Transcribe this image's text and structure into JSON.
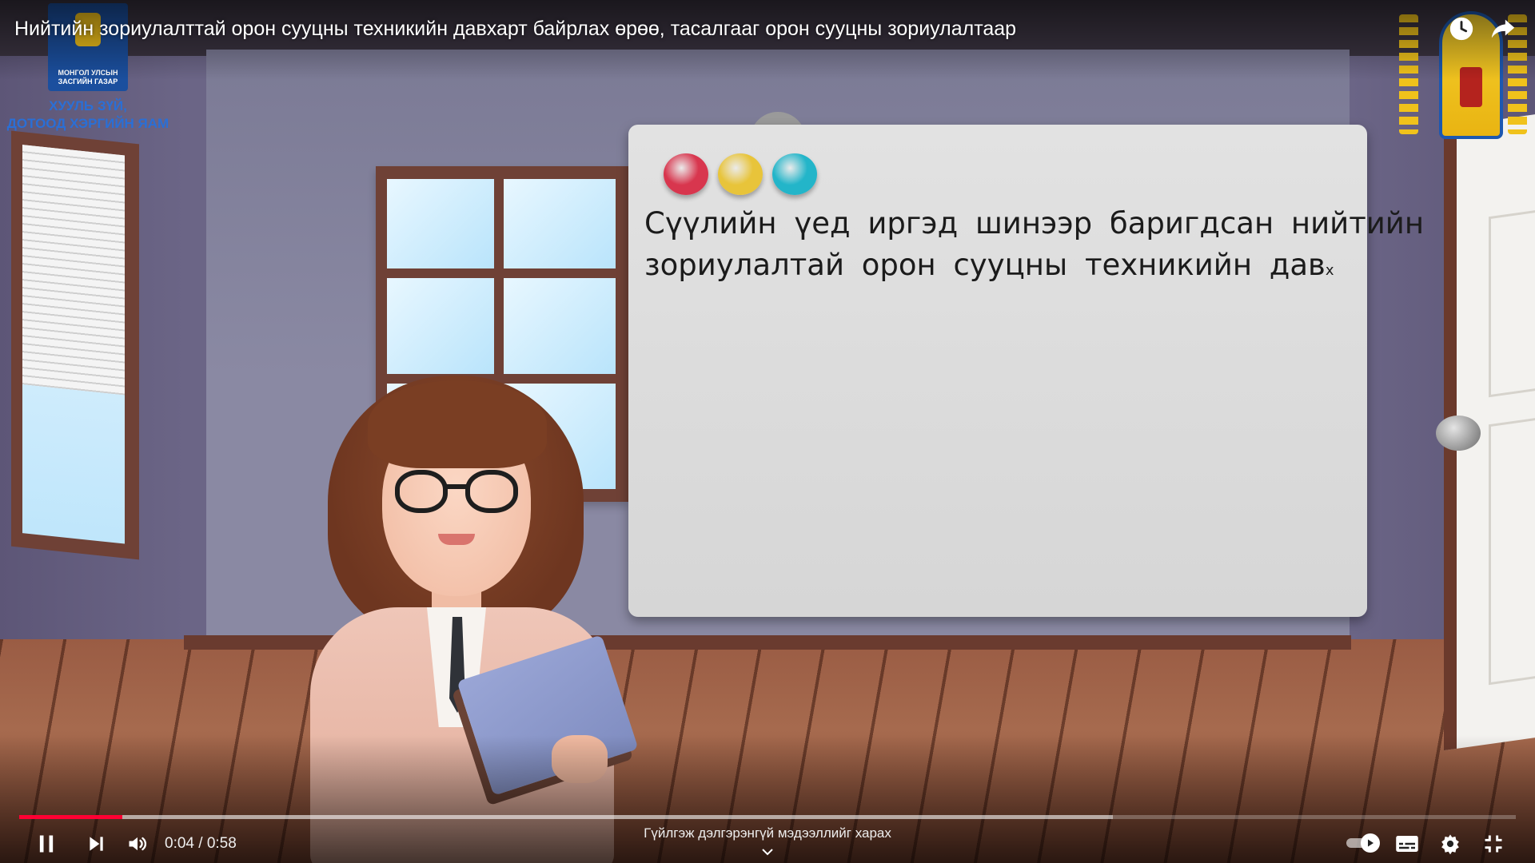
{
  "video": {
    "title": "Нийтийн зориулалттай орон сууцны техникийн давхарт байрлах өрөө, тасалгааг орон сууцны зориулалтаар"
  },
  "board": {
    "line1": "Сүүлийн үед иргэд шинээр баригдсан нийтийн",
    "line2": "зориулалтай орон сууцны техникийн дав",
    "typing_mark": "х",
    "pins": [
      "#d8364e",
      "#e8c43a",
      "#23b5c9"
    ]
  },
  "logos": {
    "left_text": "МОНГОЛ УЛСЫН ЗАСГИЙН ГАЗАР",
    "ministry_line1": "ХУУЛЬ ЗҮЙ,",
    "ministry_line2": "ДОТООД ХЭРГИЙН ЯАМ"
  },
  "player": {
    "current_time": "0:04",
    "separator": "/",
    "duration": "0:58",
    "played_fraction": 0.069,
    "buffered_fraction": 0.731,
    "hint": "Гүйлгэж дэлгэрэнгүй мэдээллийг харах",
    "accent_color": "#ff0033",
    "icons": {
      "watch_later": "clock-icon",
      "share": "share-icon",
      "pause": "pause-icon",
      "next": "next-icon",
      "volume": "volume-icon",
      "autoplay": "autoplay-toggle",
      "subtitles": "subtitles-icon",
      "settings": "gear-icon",
      "exit_fullscreen": "exit-fullscreen-icon",
      "expand_hint": "chevron-down-icon"
    }
  }
}
